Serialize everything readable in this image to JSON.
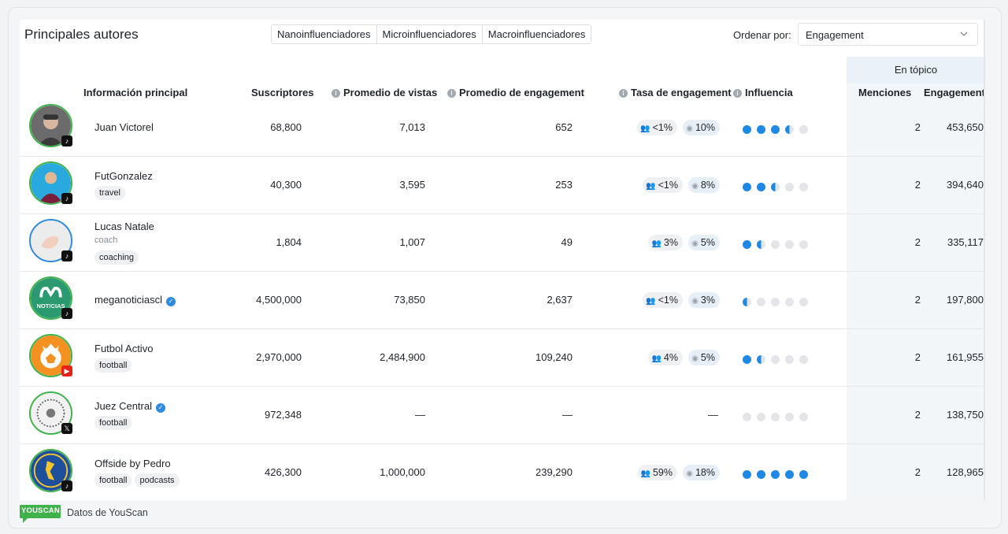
{
  "widget": {
    "title": "Principales autores",
    "segments": [
      "Nanoinfluenciadores",
      "Microinfluenciadores",
      "Macroinfluenciadores"
    ],
    "sort_label": "Ordenar por:",
    "sort_value": "Engagement"
  },
  "table": {
    "topic_group": "En tópico",
    "headers": {
      "info": "Información principal",
      "subs": "Suscriptores",
      "views": "Promedio de vistas",
      "engagement": "Promedio de engagement",
      "rate": "Tasa de engagement",
      "influence": "Influencia",
      "mentions": "Menciones",
      "topic_engagement": "Engagement"
    },
    "rows": [
      {
        "name": "Juan Victorel",
        "verified": false,
        "subtitle": "",
        "tags": [],
        "platform": "tiktok",
        "subs": "68,800",
        "views": "7,013",
        "engagement": "652",
        "rate_audience": "<1%",
        "rate_views": "10%",
        "influence_level": 3.5,
        "mentions": "2",
        "topic_engagement": "453,650"
      },
      {
        "name": "FutGonzalez",
        "verified": false,
        "subtitle": "",
        "tags": [
          "travel"
        ],
        "platform": "tiktok",
        "subs": "40,300",
        "views": "3,595",
        "engagement": "253",
        "rate_audience": "<1%",
        "rate_views": "8%",
        "influence_level": 2.5,
        "mentions": "2",
        "topic_engagement": "394,640"
      },
      {
        "name": "Lucas Natale",
        "verified": false,
        "subtitle": "coach",
        "tags": [
          "coaching"
        ],
        "platform": "tiktok",
        "subs": "1,804",
        "views": "1,007",
        "engagement": "49",
        "rate_audience": "3%",
        "rate_views": "5%",
        "influence_level": 1.5,
        "mentions": "2",
        "topic_engagement": "335,117"
      },
      {
        "name": "meganoticiascl",
        "verified": true,
        "subtitle": "",
        "tags": [],
        "platform": "tiktok",
        "subs": "4,500,000",
        "views": "73,850",
        "engagement": "2,637",
        "rate_audience": "<1%",
        "rate_views": "3%",
        "influence_level": 0.5,
        "mentions": "2",
        "topic_engagement": "197,800"
      },
      {
        "name": "Futbol Activo",
        "verified": false,
        "subtitle": "",
        "tags": [
          "football"
        ],
        "platform": "youtube",
        "subs": "2,970,000",
        "views": "2,484,900",
        "engagement": "109,240",
        "rate_audience": "4%",
        "rate_views": "5%",
        "influence_level": 1.5,
        "mentions": "2",
        "topic_engagement": "161,955"
      },
      {
        "name": "Juez Central",
        "verified": true,
        "subtitle": "",
        "tags": [
          "football"
        ],
        "platform": "x",
        "subs": "972,348",
        "views": "—",
        "engagement": "—",
        "rate_dash": "—",
        "influence_level": 0,
        "mentions": "2",
        "topic_engagement": "138,750"
      },
      {
        "name": "Offside by Pedro",
        "verified": false,
        "subtitle": "",
        "tags": [
          "football",
          "podcasts"
        ],
        "platform": "tiktok",
        "subs": "426,300",
        "views": "1,000,000",
        "engagement": "239,290",
        "rate_audience": "59%",
        "rate_views": "18%",
        "influence_level": 5,
        "mentions": "2",
        "topic_engagement": "128,965"
      }
    ]
  },
  "footer": {
    "logo_text": "YOUSCAN",
    "text": "Datos de YouScan"
  },
  "colors": {
    "accent": "#1e88e5",
    "avatar_ring": "#3fb24b",
    "verified": "#2f8ae0",
    "logo": "#3fb24b",
    "topic_column_bg": "#f3f6f9"
  }
}
